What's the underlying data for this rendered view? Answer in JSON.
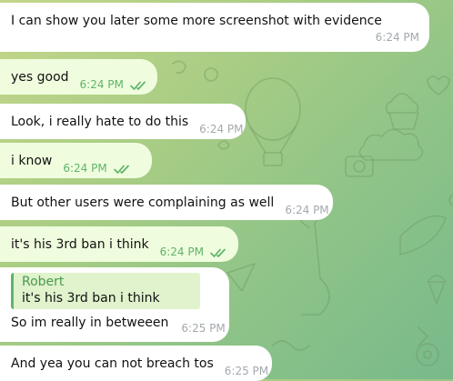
{
  "colors": {
    "incoming_bubble": "#ffffff",
    "outgoing_bubble": "#effdde",
    "outgoing_meta": "#5fb36a",
    "incoming_meta": "#a3a9ad",
    "reply_accent": "#5fb36a"
  },
  "messages": [
    {
      "direction": "in",
      "text": "I can show you later some more screenshot with evidence",
      "time": "6:24 PM"
    },
    {
      "direction": "out",
      "text": "yes good",
      "time": "6:24 PM",
      "status": "read"
    },
    {
      "direction": "in",
      "text": "Look, i really hate to do this",
      "time": "6:24 PM"
    },
    {
      "direction": "out",
      "text": "i know",
      "time": "6:24 PM",
      "status": "read"
    },
    {
      "direction": "in",
      "text": "But other users were complaining as well",
      "time": "6:24 PM"
    },
    {
      "direction": "out",
      "text": "it's his 3rd ban i think",
      "time": "6:24 PM",
      "status": "read"
    },
    {
      "direction": "in",
      "reply_to": {
        "author": "Robert",
        "text": "it's his 3rd ban i think"
      },
      "text": "So im really in betweeen",
      "time": "6:25 PM"
    },
    {
      "direction": "in",
      "text": "And yea you can not breach tos",
      "time": "6:25 PM"
    }
  ]
}
